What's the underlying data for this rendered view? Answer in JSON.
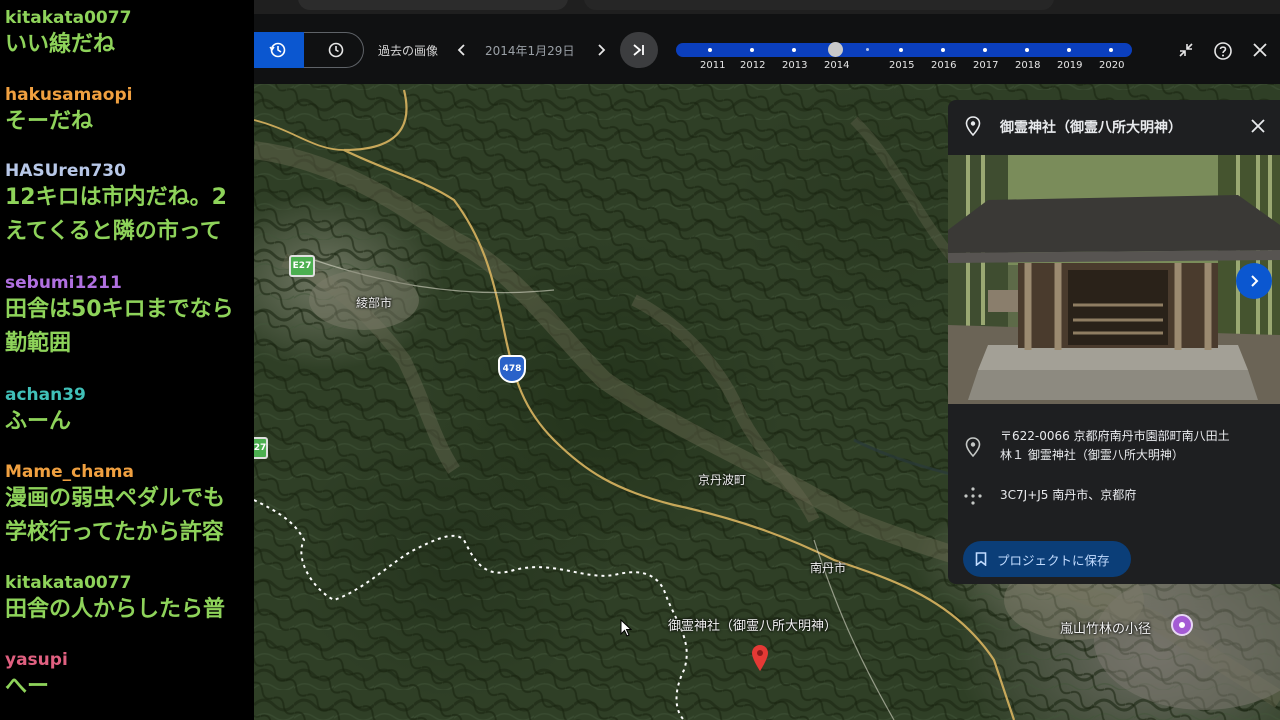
{
  "chat": {
    "messages": [
      {
        "user": "kitakata0077",
        "user_color": "#8ed35a",
        "lines": [
          "いい線だね"
        ]
      },
      {
        "user": "hakusamaopi",
        "user_color": "#f0a040",
        "lines": [
          "そーだね"
        ]
      },
      {
        "user": "HASUren730",
        "user_color": "#b8c8e8",
        "lines": [
          "12キロは市内だね。2",
          "えてくると隣の市って"
        ]
      },
      {
        "user": "sebumi1211",
        "user_color": "#b070e0",
        "lines": [
          "田舎は50キロまでなら",
          "勤範囲"
        ]
      },
      {
        "user": "achan39",
        "user_color": "#40c0b8",
        "lines": [
          "ふーん"
        ]
      },
      {
        "user": "Mame_chama",
        "user_color": "#f0a040",
        "lines": [
          "漫画の弱虫ペダルでも",
          "学校行ってたから許容"
        ]
      },
      {
        "user": "kitakata0077",
        "user_color": "#8ed35a",
        "lines": [
          "田舎の人からしたら普"
        ]
      },
      {
        "user": "yasupi",
        "user_color": "#e06080",
        "lines": [
          "へー"
        ]
      }
    ]
  },
  "timebar": {
    "past_imagery_label": "過去の画像",
    "date": "2014年1月29日",
    "years": [
      "2011",
      "2012",
      "2013",
      "2014",
      "2015",
      "2016",
      "2017",
      "2018",
      "2019",
      "2020"
    ],
    "selected_year": "2014",
    "track_color": "#0b3fbd",
    "active_color": "#0b57d0"
  },
  "panel": {
    "title": "御霊神社（御霊八所大明神）",
    "address_line1": "〒622-0066 京都府南丹市園部町南八田土",
    "address_line2": "林１ 御霊神社（御霊八所大明神）",
    "plus_code": "3C7J+J5 南丹市、京都府",
    "save_label": "プロジェクトに保存"
  },
  "map": {
    "labels": {
      "ayabe": "綾部市",
      "kyotamba": "京丹波町",
      "nantan": "南丹市",
      "shrine": "御霊神社（御霊八所大明神）",
      "arashiyama": "嵐山竹林の小径"
    },
    "shields": {
      "e27_top": "E27",
      "e27_left": "27",
      "route478": "478"
    }
  }
}
